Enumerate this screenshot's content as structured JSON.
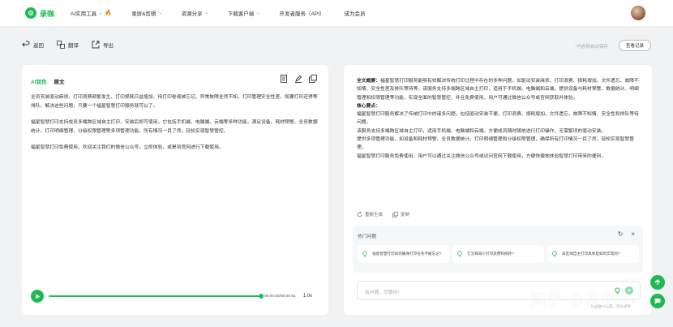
{
  "app": {
    "name": "录咖"
  },
  "nav": {
    "items": [
      {
        "label": "AI实用工具",
        "has_chevron": true,
        "hot": true
      },
      {
        "label": "录屏&剪辑",
        "has_chevron": true
      },
      {
        "label": "资源分享",
        "has_chevron": true
      },
      {
        "label": "下载客户端",
        "has_chevron": true
      },
      {
        "label": "开发者服务（API）",
        "has_chevron": false
      },
      {
        "label": "成为会员",
        "has_chevron": false
      }
    ]
  },
  "toolbar": {
    "back": "返回",
    "translate": "翻译",
    "export": "导出",
    "autosave": "*内容将自动保存",
    "view_record": "查看记录"
  },
  "left_panel": {
    "ai_tab": "AI润色",
    "original_tab": "原文",
    "paragraphs": [
      "全员安装驱动麻烦、打印浪费频繁发生、打印损耗日益增加、待打印卷易被忘记、异常故障全然不知、打印管理安全性差，既要打印还得等排队，解决这些问题，只要一个福星智慧打印服务就可以了。",
      "福星智慧打印支持成员多端跨区域自主打印、安装后即可使用，它包括手机端、电脑端、云端等多种功能，满足设备、耗材预警、全员数据统计、打印明细管理、分级权限管理等多项管理功能。所有情况一目了然，轻松实现智慧管控。",
      "福星智慧打印免费使用，欢迎关注我们的微信公众号，立即体验，或是到官网进行下载使用。"
    ],
    "player": {
      "time": "00:00:00/00:00:51",
      "speed": "1.0x",
      "progress": 1.0
    }
  },
  "right_panel": {
    "summary_label": "全文概要：",
    "summary_text": "福星智慧打印服务能够有效解决传统打印过程中存在的多种问题，如驱动安装麻烦、打印浪费、损耗增加、文件遗忘、故障不知情、安全性差及排队等待等。该服务支持多端跨区域自主打印，适用于手机端、电脑端和云端，提供设备与耗材预警、数据统计、明细管理和权限管理等功能，实现全面的智慧管控，并且免费使用，用户可通过微信公众号或官网获取并体验。",
    "points_label": "核心要点：",
    "points": [
      "福星智慧打印服务解决了传统打印中的诸多问题，包括驱动安装不便、打印浪费、损耗增加、文件遗忘、故障不知情、安全性和排队等待问题。",
      "该服务支持多端跨区域自主打印，适用手机端、电脑端和云端，方便成员随时随地进行打印操作，无需繁琐的驱动安装。",
      "提供多项管理功能，如设备和耗材预警、全员数据统计、打印明细管理和分级权限管理，确保所有打印情况一目了然，轻松实现智慧管理。",
      "福星智慧打印服务免费使用，用户可以通过关注微信公众号或访问官网下载使用，方便快捷地体验智慧打印带来的便利。"
    ],
    "actions": {
      "regenerate": "重新生成",
      "copy": "复制"
    },
    "hot": {
      "title": "热门问题",
      "questions": [
        "福星智慧打印如何确保打印任务不被忘记?",
        "它怎样减少打印浪费和损耗?",
        "异区域自主打印具体是如何实现的?"
      ]
    },
    "ask": {
      "placeholder": "有问题，尽管问!",
      "disclaimer": "内容由AI生成，仅供参考"
    }
  },
  "watermark": "知乎 @方小小",
  "colors": {
    "brand": "#1fb955",
    "fire": "#ff5a1f"
  }
}
